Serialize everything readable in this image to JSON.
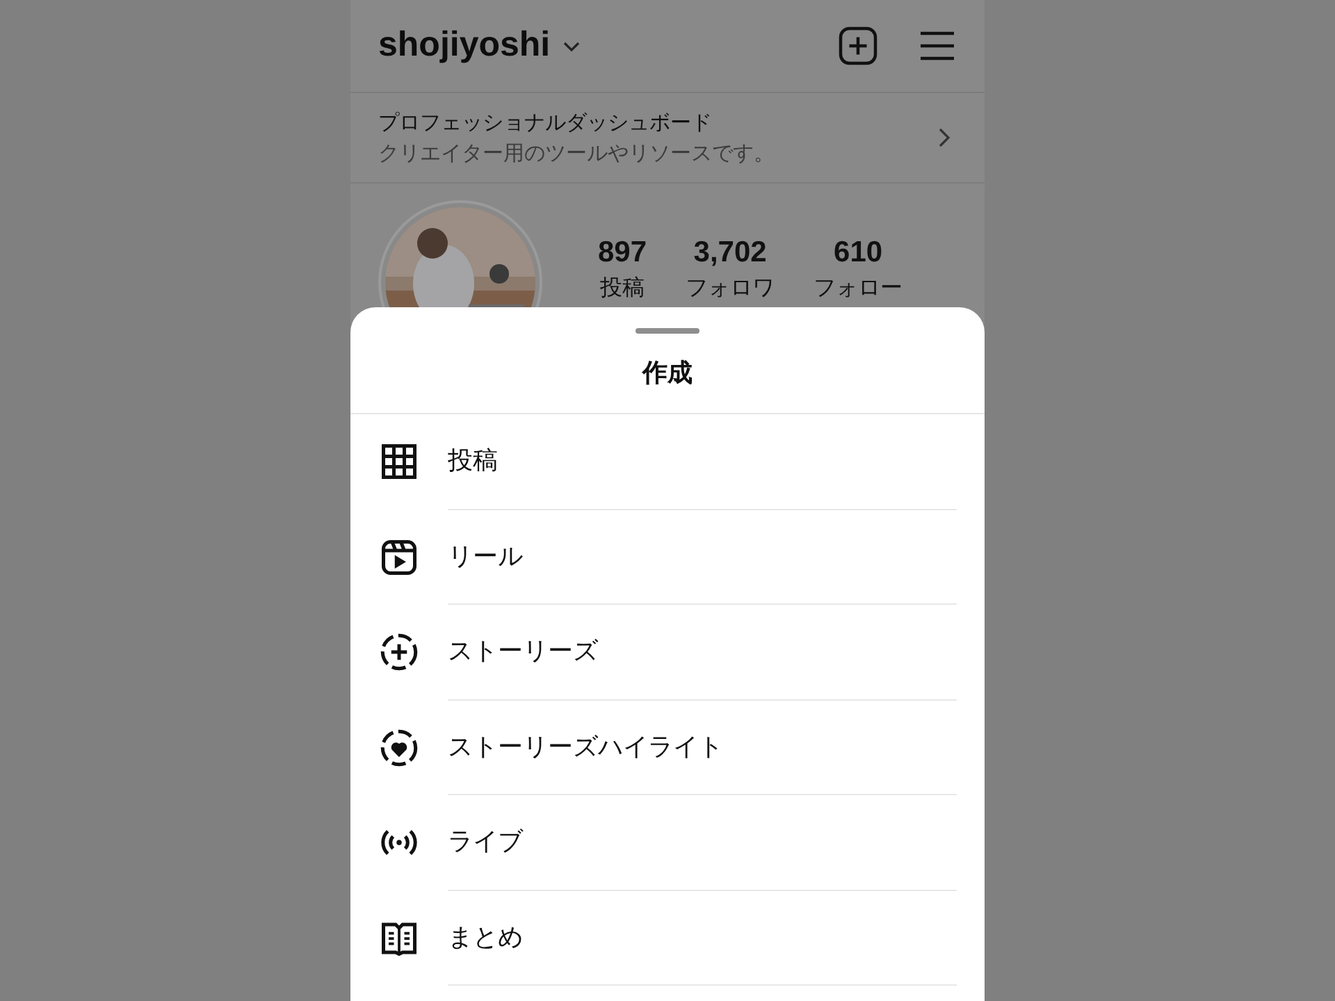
{
  "header": {
    "username": "shojiyoshi"
  },
  "dashboard": {
    "title": "プロフェッショナルダッシュボード",
    "subtitle": "クリエイター用のツールやリソースです。"
  },
  "profile": {
    "stats": [
      {
        "value": "897",
        "label": "投稿"
      },
      {
        "value": "3,702",
        "label": "フォロワ"
      },
      {
        "value": "610",
        "label": "フォロー"
      }
    ]
  },
  "sheet": {
    "title": "作成",
    "items": [
      {
        "kind": "grid",
        "label": "投稿"
      },
      {
        "kind": "reel",
        "label": "リール"
      },
      {
        "kind": "story",
        "label": "ストーリーズ"
      },
      {
        "kind": "highlight",
        "label": "ストーリーズハイライト"
      },
      {
        "kind": "live",
        "label": "ライブ"
      },
      {
        "kind": "guide",
        "label": "まとめ"
      }
    ]
  }
}
